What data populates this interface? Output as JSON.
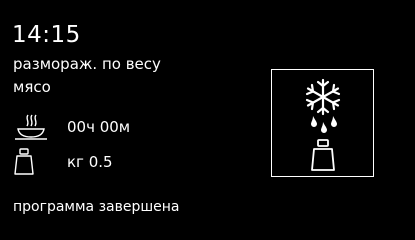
{
  "display": {
    "clock": "14:15",
    "program_name": "размораж. по весу",
    "food_type": "мясо",
    "duration_value": "00ч 00м",
    "weight_value": "кг 0.5",
    "status_message": "программа завершена"
  },
  "icons": {
    "duration": "steaming-dish-icon",
    "weight": "weight-icon",
    "program": "defrost-snowflake-weight-icon"
  },
  "colors": {
    "background": "#000000",
    "foreground": "#ffffff"
  }
}
